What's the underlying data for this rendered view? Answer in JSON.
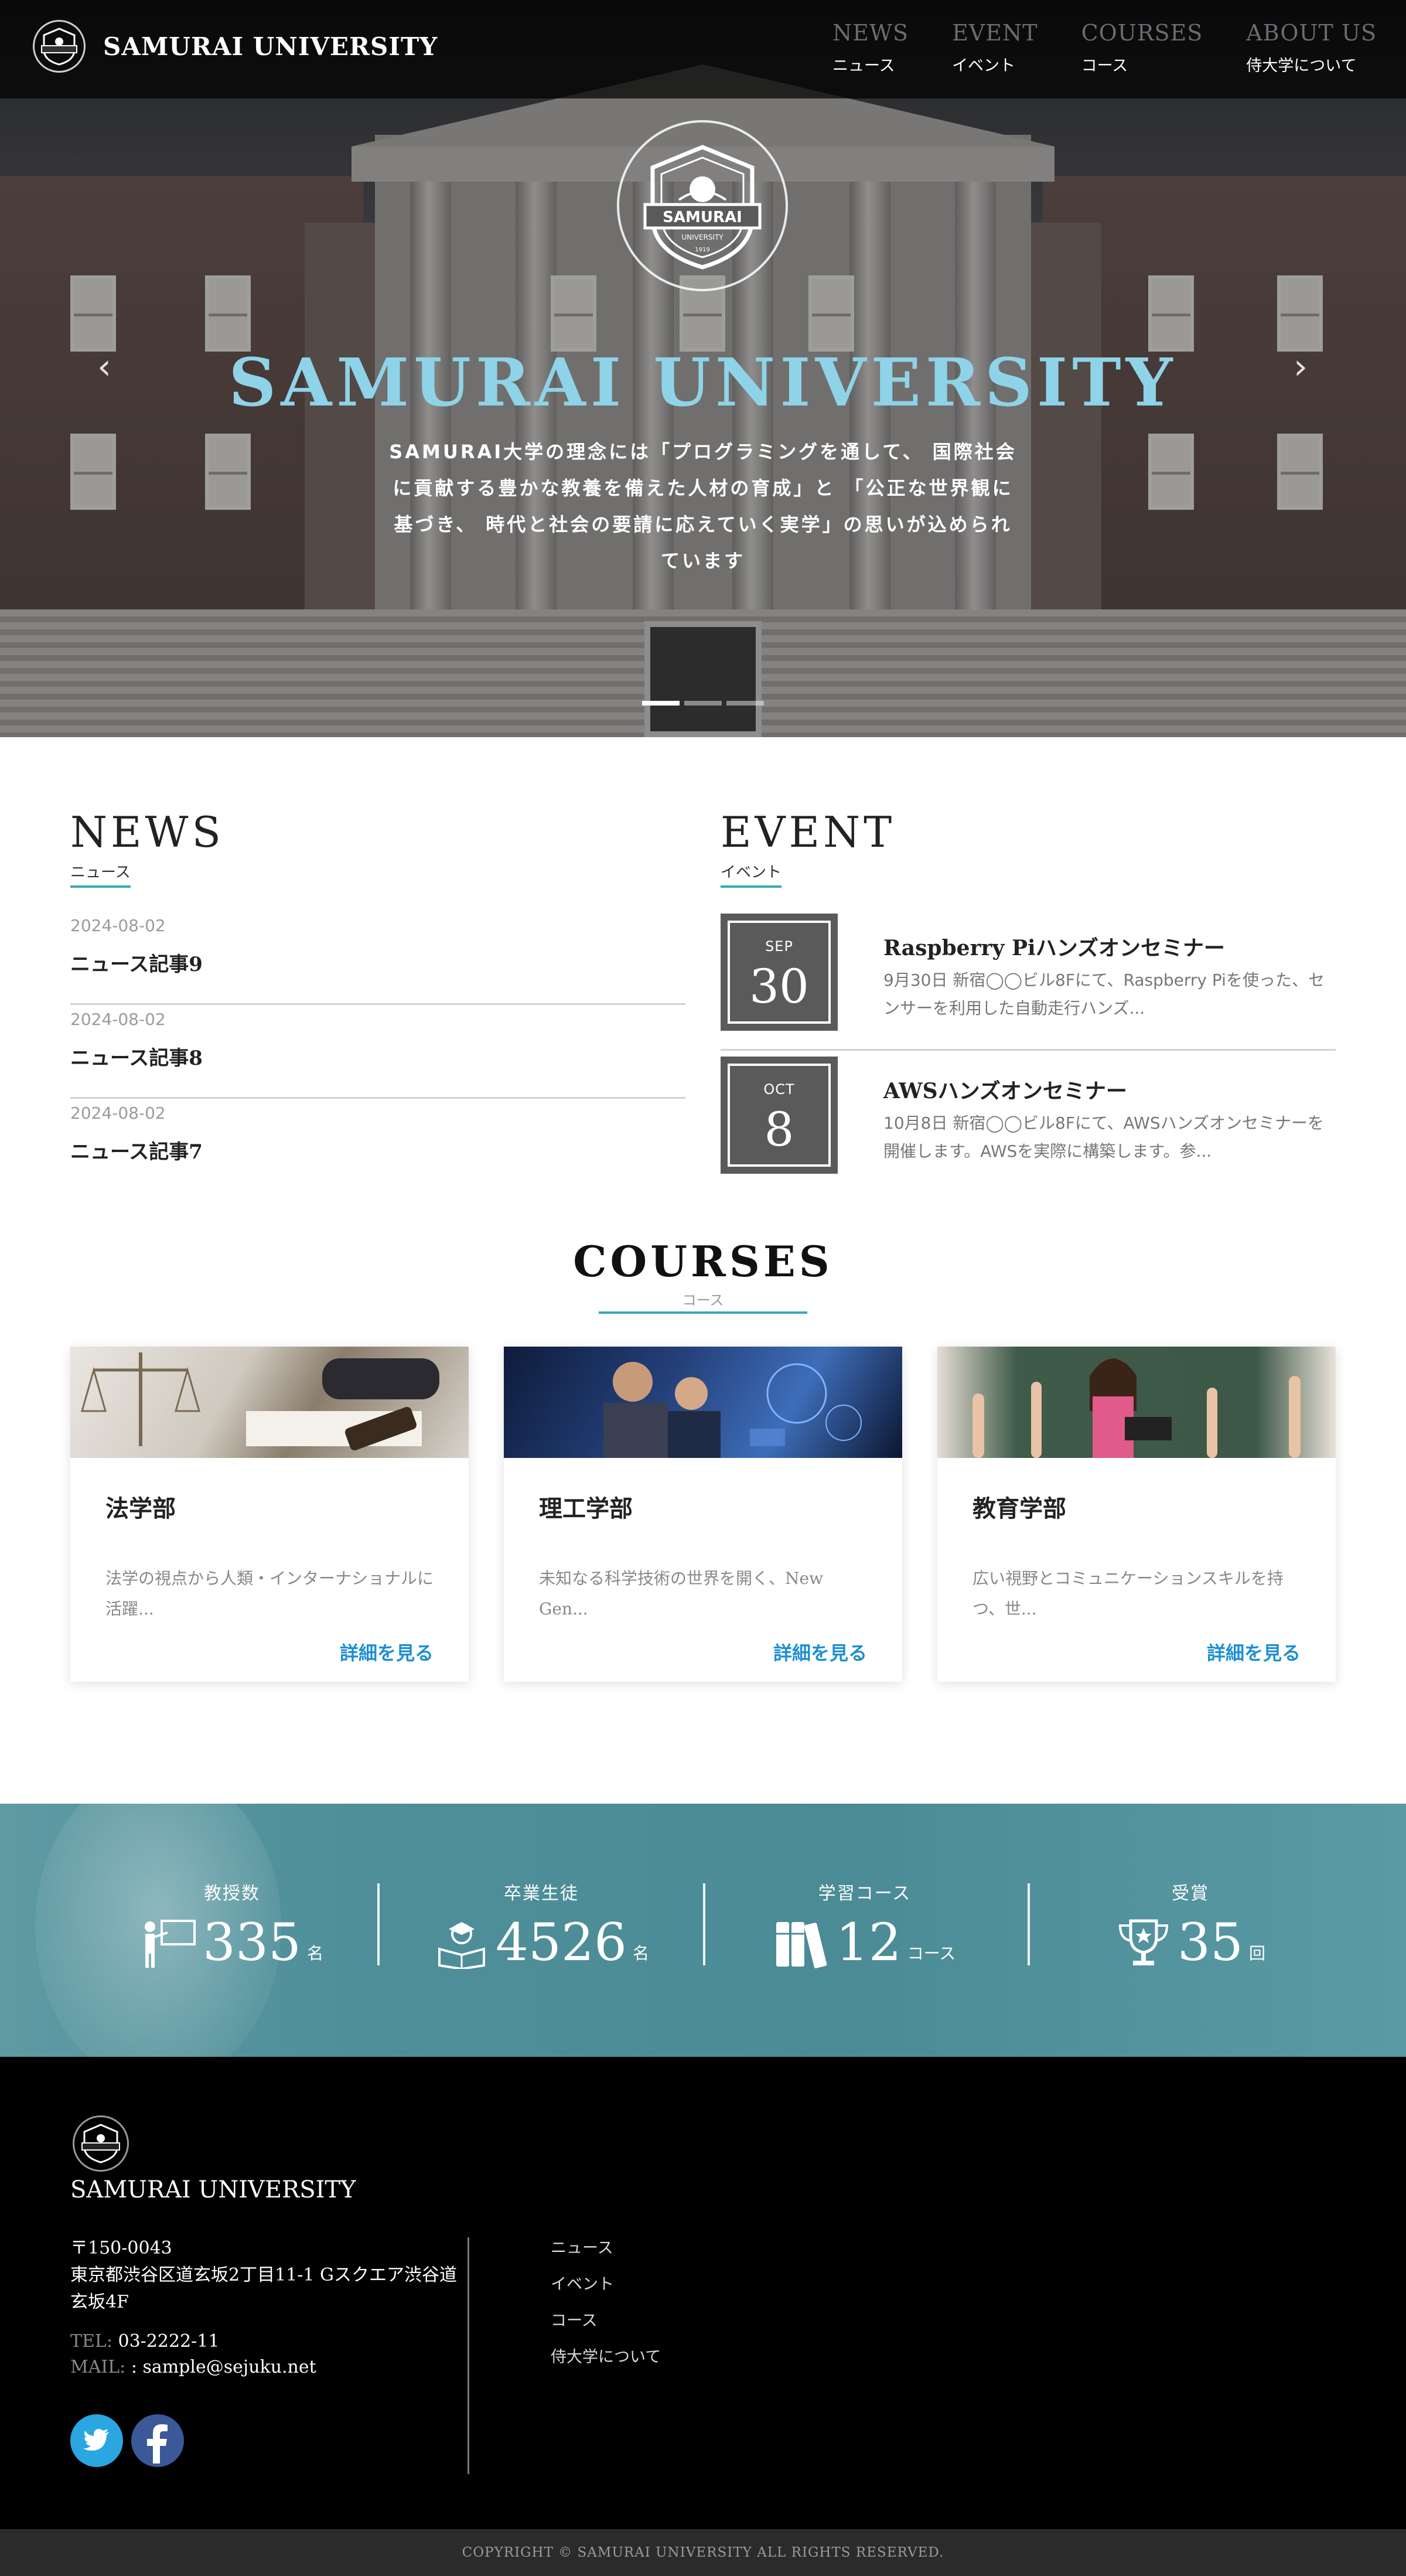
{
  "header": {
    "brand": "SAMURAI UNIVERSITY",
    "nav": [
      {
        "en": "NEWS",
        "ja": "ニュース"
      },
      {
        "en": "EVENT",
        "ja": "イベント"
      },
      {
        "en": "COURSES",
        "ja": "コース"
      },
      {
        "en": "ABOUT US",
        "ja": "侍大学について"
      }
    ]
  },
  "hero": {
    "logo_text": "SAMURAI",
    "logo_sub": "UNIVERSITY",
    "logo_year": "1919",
    "title": "SAMURAI UNIVERSITY",
    "description": "SAMURAI大学の理念には「プログラミングを通して、 国際社会に貢献する豊かな教養を備えた人材の育成」と 「公正な世界観に基づき、 時代と社会の要請に応えていく実学」の思いが込められています",
    "prev_icon": "chevron-left-icon",
    "next_icon": "chevron-right-icon",
    "slide_count": 3,
    "active_slide": 1
  },
  "news": {
    "title": "NEWS",
    "subtitle": "ニュース",
    "items": [
      {
        "date": "2024-08-02",
        "title": "ニュース記事9"
      },
      {
        "date": "2024-08-02",
        "title": "ニュース記事8"
      },
      {
        "date": "2024-08-02",
        "title": "ニュース記事7"
      }
    ]
  },
  "event": {
    "title": "EVENT",
    "subtitle": "イベント",
    "items": [
      {
        "month": "SEP",
        "day": "30",
        "title": "Raspberry Piハンズオンセミナー",
        "desc": "9月30日 新宿◯◯ビル8Fにて、Raspberry Piを使った、センサーを利用した自動走行ハンズ..."
      },
      {
        "month": "OCT",
        "day": "8",
        "title": "AWSハンズオンセミナー",
        "desc": "10月8日 新宿◯◯ビル8Fにて、AWSハンズオンセミナーを開催します。AWSを実際に構築します。参..."
      }
    ]
  },
  "courses": {
    "title": "COURSES",
    "subtitle": "コース",
    "items": [
      {
        "name": "法学部",
        "desc": "法学の視点から人類・インターナショナルに活躍...",
        "link": "詳細を見る"
      },
      {
        "name": "理工学部",
        "desc": "未知なる科学技術の世界を開く、New Gen...",
        "link": "詳細を見る"
      },
      {
        "name": "教育学部",
        "desc": "広い視野とコミュニケーションスキルを持つ、世...",
        "link": "詳細を見る"
      }
    ]
  },
  "stats": [
    {
      "label": "教授数",
      "value": "335",
      "unit": "名",
      "icon": "professor-icon"
    },
    {
      "label": "卒業生徒",
      "value": "4526",
      "unit": "名",
      "icon": "graduate-icon"
    },
    {
      "label": "学習コース",
      "value": "12",
      "unit": "コース",
      "icon": "books-icon"
    },
    {
      "label": "受賞",
      "value": "35",
      "unit": "回",
      "icon": "trophy-icon"
    }
  ],
  "footer": {
    "name": "SAMURAI UNIVERSITY",
    "zip": "〒150-0043",
    "address": "東京都渋谷区道玄坂2丁目11-1 Gスクエア渋谷道玄坂4F",
    "tel_label": "TEL:",
    "tel": "03-2222-11",
    "mail_label": "MAIL:",
    "mail": ": sample@sejuku.net",
    "links": [
      "ニュース",
      "イベント",
      "コース",
      "侍大学について"
    ],
    "copyright": "COPYRIGHT © SAMURAI UNIVERSITY ALL RIGHTS RESERVED."
  },
  "colors": {
    "accent": "#3aa6b9",
    "hero_title": "#8fd3e8",
    "link": "#1d8fd2",
    "stats_bg": "#4e8f99",
    "twitter": "#2aa6e0",
    "facebook": "#3b5998"
  }
}
